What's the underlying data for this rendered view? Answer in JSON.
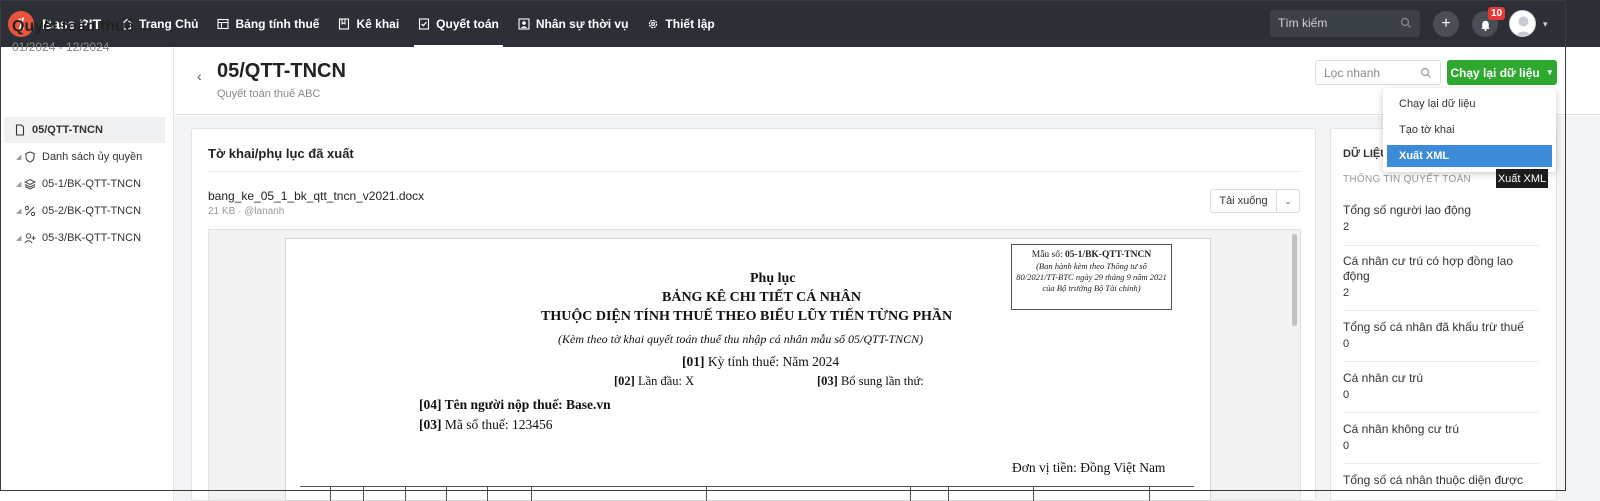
{
  "app": {
    "logo_glyph": "⁒",
    "name": "Base PIT"
  },
  "nav": [
    {
      "label": "Trang Chủ",
      "icon": "home-icon"
    },
    {
      "label": "Bảng tính thuế",
      "icon": "table-icon"
    },
    {
      "label": "Kê khai",
      "icon": "declare-icon"
    },
    {
      "label": "Quyết toán",
      "icon": "checklist-icon",
      "active": true
    },
    {
      "label": "Nhân sự thời vụ",
      "icon": "person-card-icon"
    },
    {
      "label": "Thiết lập",
      "icon": "gear-icon"
    }
  ],
  "topbar": {
    "search_placeholder": "Tìm kiếm",
    "notification_count": "10",
    "add_glyph": "+"
  },
  "sidebar": {
    "title": "Quyết toán thuế ...",
    "period": "01/2024 - 12/2024",
    "items": [
      {
        "label": "05/QTT-TNCN",
        "icon": "file-icon",
        "active": true
      },
      {
        "label": "Danh sách ủy quyền",
        "icon": "shield-icon"
      },
      {
        "label": "05-1/BK-QTT-TNCN",
        "icon": "layers-icon"
      },
      {
        "label": "05-2/BK-QTT-TNCN",
        "icon": "percent-icon"
      },
      {
        "label": "05-3/BK-QTT-TNCN",
        "icon": "user-add-icon"
      }
    ]
  },
  "header": {
    "title": "05/QTT-TNCN",
    "subtitle": "Quyết toán thuế ABC",
    "filter_placeholder": "Lọc nhanh",
    "run_button": "Chạy lại dữ liệu",
    "run_caret": "▼",
    "back_glyph": "‹"
  },
  "dropdown": {
    "items": [
      "Chạy lại dữ liệu",
      "Tạo tờ khai",
      "Xuất XML"
    ],
    "highlighted": "Xuất XML",
    "tooltip": "Xuất XML",
    "highlight_color": "#3d8bd8"
  },
  "exported": {
    "title": "Tờ khai/phụ lục đã xuất",
    "file_name": "bang_ke_05_1_bk_qtt_tncn_v2021.docx",
    "file_meta": "21 KB · @lananh",
    "download_label": "Tải xuống",
    "download_caret": "⌄"
  },
  "document": {
    "form_no_prefix": "Mẫu số: ",
    "form_no": "05-1/BK-QTT-TNCN",
    "form_desc": "(Ban hành kèm theo Thông tư số 80/2021/TT-BTC ngày 29 tháng 9 năm 2021 của Bộ trưởng Bộ Tài chính)",
    "heading1": "Phụ lục",
    "heading2": "BẢNG KÊ CHI TIẾT CÁ NHÂN",
    "heading3": "THUỘC DIỆN TÍNH THUẾ THEO BIỂU LŨY TIẾN TỪNG PHẦN",
    "heading4": "(Kèm theo tờ khai quyết toán thuế thu nhập cá nhân mẫu số 05/QTT-TNCN)",
    "f01_code": "[01]",
    "f01_text": " Kỳ tính thuế: Năm 2024",
    "f02_code": "[02]",
    "f02_text": " Lần đầu:  X",
    "f03b_code": "[03]",
    "f03b_text": " Bổ sung lần thứ:",
    "f04_code": "[04]",
    "f04_text": " Tên người nộp thuế: Base.vn",
    "f03_code": "[03]",
    "f03_text": " Mã số thuế: 123456",
    "currency": "Đơn vị tiền: Đồng Việt Nam"
  },
  "right_panel": {
    "heading": "DỮ LIỆU",
    "section": "THÔNG TIN QUYẾT TOÁN",
    "fields": [
      {
        "label": "Tổng số người lao động",
        "value": "2"
      },
      {
        "label": "Cá nhân cư trú có hợp đồng lao động",
        "value": "2"
      },
      {
        "label": "Tổng số cá nhân đã khấu trừ thuế",
        "value": "0"
      },
      {
        "label": "Cá nhân cư trú",
        "value": "0"
      },
      {
        "label": "Cá nhân không cư trú",
        "value": "0"
      },
      {
        "label": "Tổng số cá nhân thuộc diện được",
        "value": ""
      }
    ]
  },
  "colors": {
    "topbar": "#2c3036",
    "brand": "#e8553a",
    "primary_button": "#2ea82e",
    "badge": "#e53935"
  }
}
